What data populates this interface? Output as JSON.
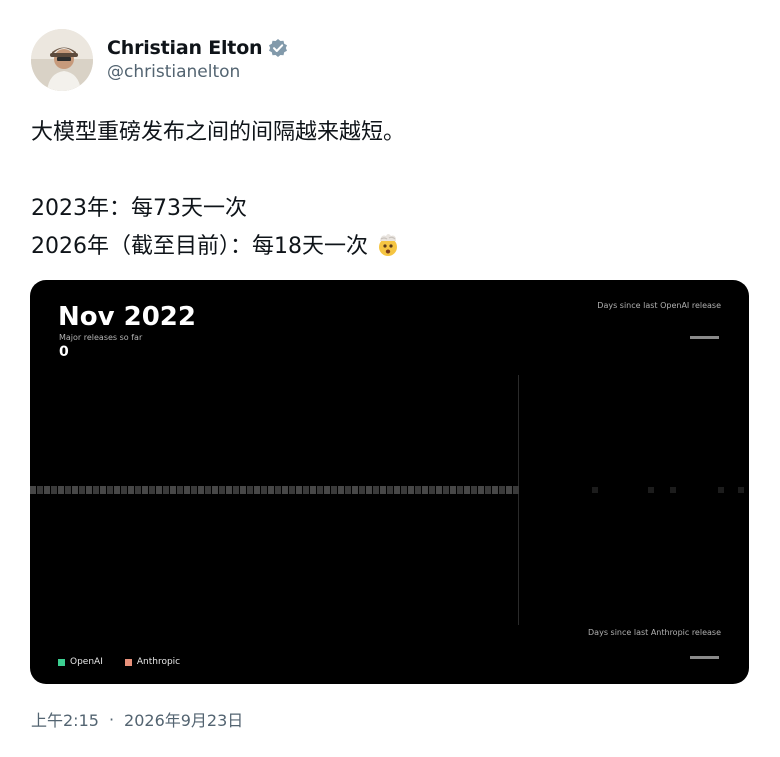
{
  "author": {
    "display_name": "Christian Elton",
    "handle": "@christianelton",
    "verified_icon": "verified-badge-icon"
  },
  "tweet": {
    "line1": "大模型重磅发布之间的间隔越来越短。",
    "line2": "2023年：每73天一次",
    "line3": "2026年（截至目前）：每18天一次",
    "emoji": "exploding-head-emoji"
  },
  "media": {
    "month": "Nov 2022",
    "releases_label": "Major releases so far",
    "release_count": "0",
    "openai_days_label": "Days since last OpenAI release",
    "anthropic_days_label": "Days since last Anthropic release",
    "legend": [
      {
        "label": "OpenAI",
        "color": "#3ccf91"
      },
      {
        "label": "Anthropic",
        "color": "#e8917b"
      }
    ]
  },
  "meta": {
    "time": "上午2:15",
    "separator": "·",
    "date": "2026年9月23日"
  }
}
